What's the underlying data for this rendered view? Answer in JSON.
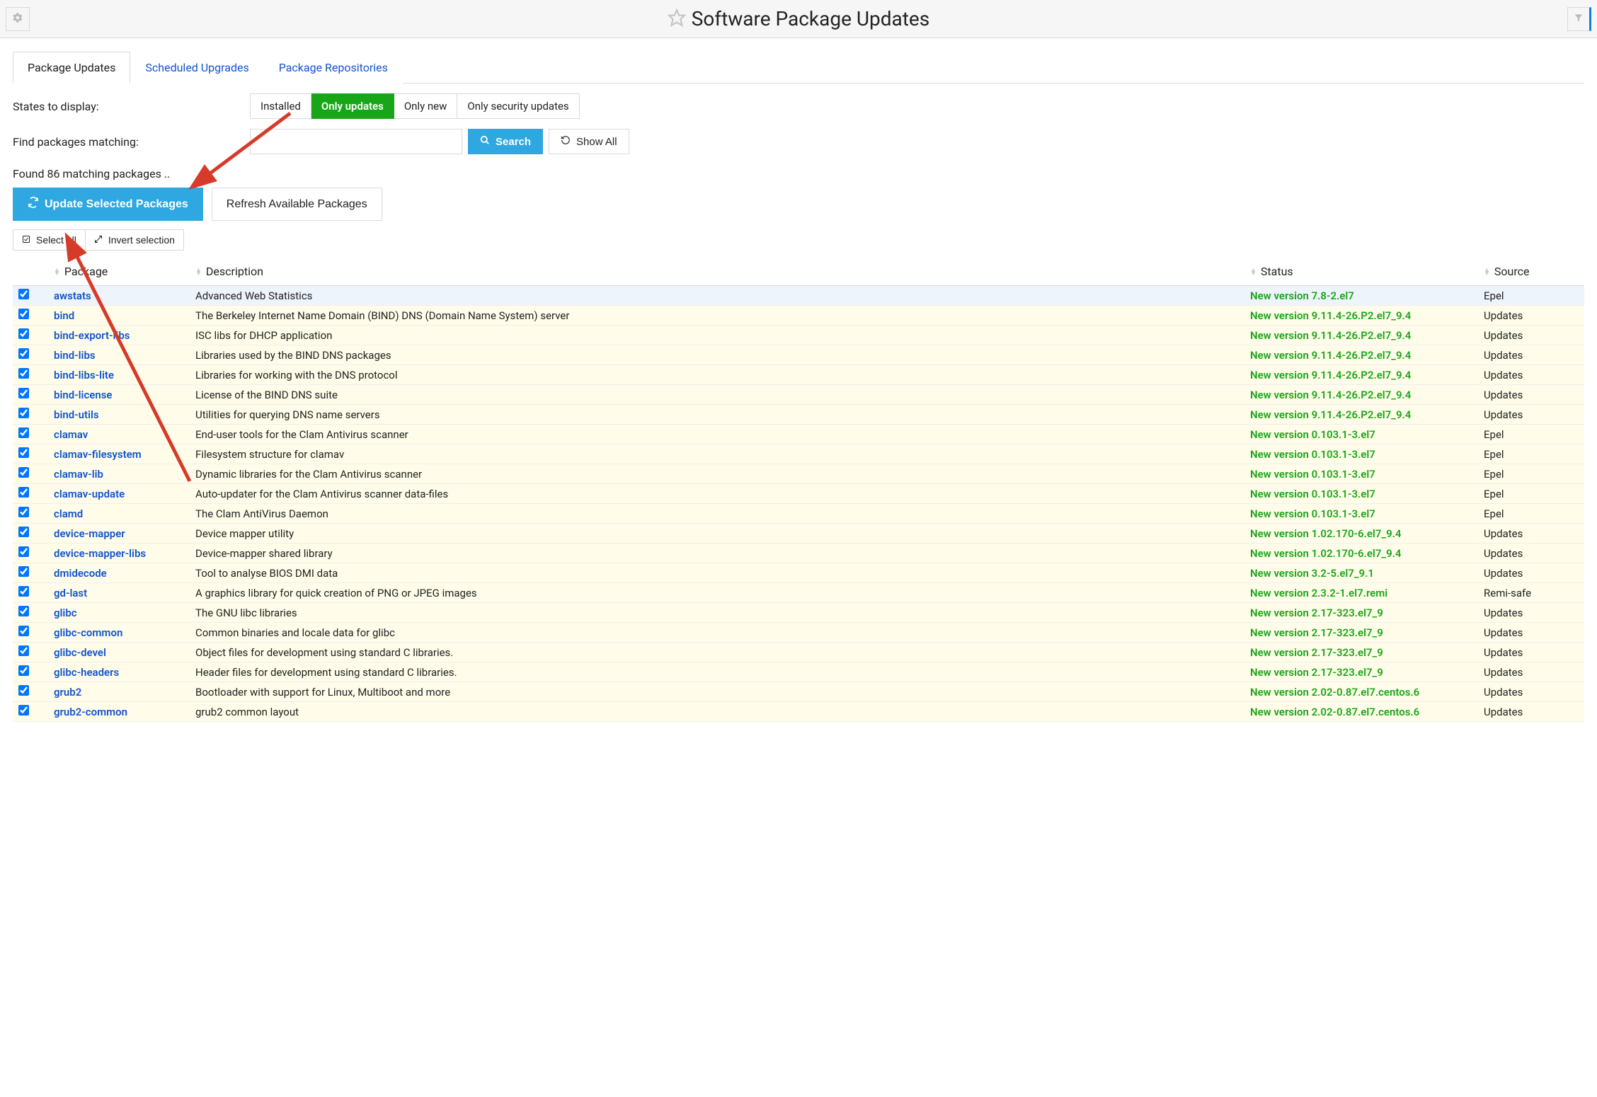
{
  "header": {
    "title": "Software Package Updates"
  },
  "tabs": [
    {
      "label": "Package Updates",
      "active": true
    },
    {
      "label": "Scheduled Upgrades",
      "active": false
    },
    {
      "label": "Package Repositories",
      "active": false
    }
  ],
  "filters": {
    "states_label": "States to display:",
    "options": [
      {
        "label": "Installed",
        "active": false
      },
      {
        "label": "Only updates",
        "active": true
      },
      {
        "label": "Only new",
        "active": false
      },
      {
        "label": "Only security updates",
        "active": false
      }
    ],
    "find_label": "Find packages matching:",
    "search_value": "",
    "search_button": "Search",
    "showall_button": "Show All"
  },
  "found_text": "Found 86 matching packages ..",
  "actions": {
    "update_button": "Update Selected Packages",
    "refresh_button": "Refresh Available Packages",
    "select_all": "Select all",
    "invert": "Invert selection"
  },
  "columns": {
    "package": "Package",
    "description": "Description",
    "status": "Status",
    "source": "Source"
  },
  "packages": [
    {
      "checked": true,
      "name": "awstats",
      "desc": "Advanced Web Statistics",
      "status": "New version 7.8-2.el7",
      "source": "Epel",
      "hover": true
    },
    {
      "checked": true,
      "name": "bind",
      "desc": "The Berkeley Internet Name Domain (BIND) DNS (Domain Name System) server",
      "status": "New version 9.11.4-26.P2.el7_9.4",
      "source": "Updates"
    },
    {
      "checked": true,
      "name": "bind-export-libs",
      "desc": "ISC libs for DHCP application",
      "status": "New version 9.11.4-26.P2.el7_9.4",
      "source": "Updates"
    },
    {
      "checked": true,
      "name": "bind-libs",
      "desc": "Libraries used by the BIND DNS packages",
      "status": "New version 9.11.4-26.P2.el7_9.4",
      "source": "Updates"
    },
    {
      "checked": true,
      "name": "bind-libs-lite",
      "desc": "Libraries for working with the DNS protocol",
      "status": "New version 9.11.4-26.P2.el7_9.4",
      "source": "Updates"
    },
    {
      "checked": true,
      "name": "bind-license",
      "desc": "License of the BIND DNS suite",
      "status": "New version 9.11.4-26.P2.el7_9.4",
      "source": "Updates"
    },
    {
      "checked": true,
      "name": "bind-utils",
      "desc": "Utilities for querying DNS name servers",
      "status": "New version 9.11.4-26.P2.el7_9.4",
      "source": "Updates"
    },
    {
      "checked": true,
      "name": "clamav",
      "desc": "End-user tools for the Clam Antivirus scanner",
      "status": "New version 0.103.1-3.el7",
      "source": "Epel"
    },
    {
      "checked": true,
      "name": "clamav-filesystem",
      "desc": "Filesystem structure for clamav",
      "status": "New version 0.103.1-3.el7",
      "source": "Epel"
    },
    {
      "checked": true,
      "name": "clamav-lib",
      "desc": "Dynamic libraries for the Clam Antivirus scanner",
      "status": "New version 0.103.1-3.el7",
      "source": "Epel"
    },
    {
      "checked": true,
      "name": "clamav-update",
      "desc": "Auto-updater for the Clam Antivirus scanner data-files",
      "status": "New version 0.103.1-3.el7",
      "source": "Epel"
    },
    {
      "checked": true,
      "name": "clamd",
      "desc": "The Clam AntiVirus Daemon",
      "status": "New version 0.103.1-3.el7",
      "source": "Epel"
    },
    {
      "checked": true,
      "name": "device-mapper",
      "desc": "Device mapper utility",
      "status": "New version 1.02.170-6.el7_9.4",
      "source": "Updates"
    },
    {
      "checked": true,
      "name": "device-mapper-libs",
      "desc": "Device-mapper shared library",
      "status": "New version 1.02.170-6.el7_9.4",
      "source": "Updates"
    },
    {
      "checked": true,
      "name": "dmidecode",
      "desc": "Tool to analyse BIOS DMI data",
      "status": "New version 3.2-5.el7_9.1",
      "source": "Updates"
    },
    {
      "checked": true,
      "name": "gd-last",
      "desc": "A graphics library for quick creation of PNG or JPEG images",
      "status": "New version 2.3.2-1.el7.remi",
      "source": "Remi-safe"
    },
    {
      "checked": true,
      "name": "glibc",
      "desc": "The GNU libc libraries",
      "status": "New version 2.17-323.el7_9",
      "source": "Updates"
    },
    {
      "checked": true,
      "name": "glibc-common",
      "desc": "Common binaries and locale data for glibc",
      "status": "New version 2.17-323.el7_9",
      "source": "Updates"
    },
    {
      "checked": true,
      "name": "glibc-devel",
      "desc": "Object files for development using standard C libraries.",
      "status": "New version 2.17-323.el7_9",
      "source": "Updates"
    },
    {
      "checked": true,
      "name": "glibc-headers",
      "desc": "Header files for development using standard C libraries.",
      "status": "New version 2.17-323.el7_9",
      "source": "Updates"
    },
    {
      "checked": true,
      "name": "grub2",
      "desc": "Bootloader with support for Linux, Multiboot and more",
      "status": "New version 2.02-0.87.el7.centos.6",
      "source": "Updates"
    },
    {
      "checked": true,
      "name": "grub2-common",
      "desc": "grub2 common layout",
      "status": "New version 2.02-0.87.el7.centos.6",
      "source": "Updates"
    }
  ]
}
